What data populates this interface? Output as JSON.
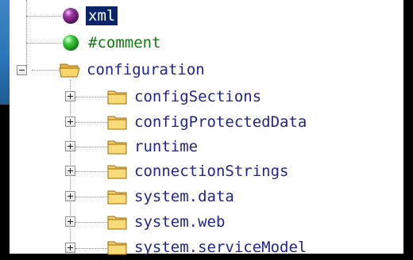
{
  "tree": {
    "nodes": [
      {
        "label": "xml",
        "type": "processing-instruction",
        "icon": "purple-sphere-icon",
        "selected": true
      },
      {
        "label": "#comment",
        "type": "comment",
        "icon": "green-sphere-icon"
      },
      {
        "label": "configuration",
        "type": "element",
        "icon": "folder-open-icon",
        "expander": "collapse"
      },
      {
        "label": "configSections",
        "type": "element",
        "icon": "folder-icon",
        "expander": "expand"
      },
      {
        "label": "configProtectedData",
        "type": "element",
        "icon": "folder-icon",
        "expander": "expand"
      },
      {
        "label": "runtime",
        "type": "element",
        "icon": "folder-icon",
        "expander": "expand"
      },
      {
        "label": "connectionStrings",
        "type": "element",
        "icon": "folder-icon",
        "expander": "expand"
      },
      {
        "label": "system.data",
        "type": "element",
        "icon": "folder-icon",
        "expander": "expand"
      },
      {
        "label": "system.web",
        "type": "element",
        "icon": "folder-icon",
        "expander": "expand"
      },
      {
        "label": "system.serviceModel",
        "type": "element",
        "icon": "folder-icon",
        "expander": "expand"
      }
    ]
  },
  "colors": {
    "label_text": "#23238e",
    "comment_text": "#107a10",
    "selection_background": "#0a246a",
    "folder": "#f4cf5e",
    "sphere_purple": "#7a1f82",
    "sphere_green": "#2fbf2f"
  }
}
